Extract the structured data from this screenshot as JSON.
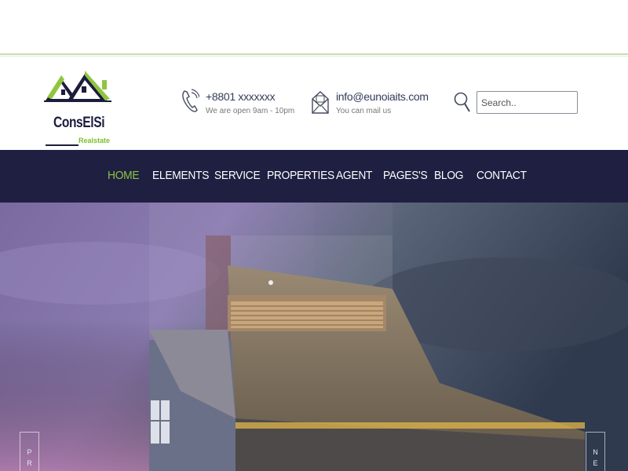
{
  "brand": {
    "name": "ConsElSi",
    "tagline": "Realstate",
    "accent": "#8ec63f",
    "dark": "#1f1f42"
  },
  "contacts": [
    {
      "icon": "phone-icon",
      "main": "+8801 xxxxxxx",
      "sub": "We are open 9am - 10pm"
    },
    {
      "icon": "mail-icon",
      "main": "info@eunoiaits.com",
      "sub": "You can mail us"
    }
  ],
  "search": {
    "placeholder": "Search.."
  },
  "nav": {
    "items": [
      {
        "label": "HOME",
        "active": true
      },
      {
        "label": "ELEMENTS",
        "active": false
      },
      {
        "label": "SERVICE",
        "active": false
      },
      {
        "label": "PROPERTIES",
        "active": false
      },
      {
        "label": "AGENT",
        "active": false
      },
      {
        "label": "PAGES'S",
        "active": false
      },
      {
        "label": "BLOG",
        "active": false
      },
      {
        "label": "CONTACT",
        "active": false
      }
    ]
  },
  "hero": {
    "prev_label": "PR",
    "next_label": "NE"
  }
}
